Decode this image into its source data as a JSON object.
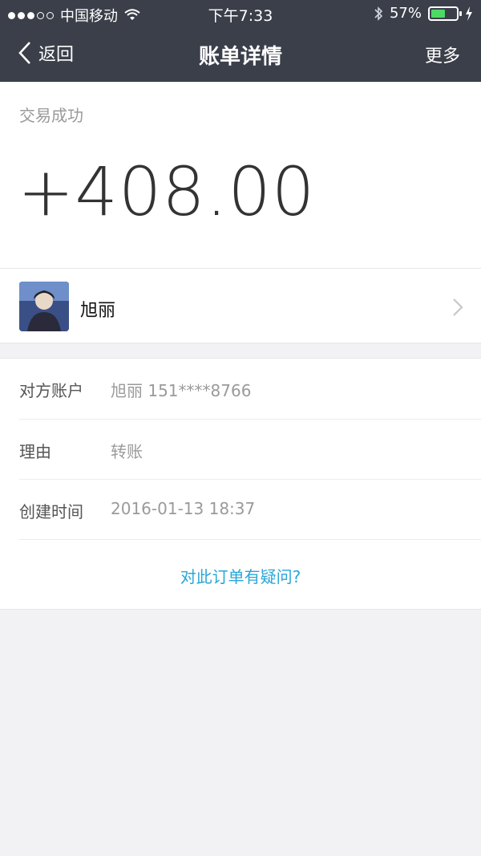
{
  "statusbar": {
    "carrier": "中国移动",
    "time": "下午7:33",
    "battery": "57%",
    "battery_level": 0.57
  },
  "nav": {
    "back_label": "返回",
    "title": "账单详情",
    "more_label": "更多"
  },
  "summary": {
    "status": "交易成功",
    "amount": "+408.00"
  },
  "user": {
    "name": "旭丽"
  },
  "details": [
    {
      "label": "对方账户",
      "value": "旭丽 151****8766"
    },
    {
      "label": "理由",
      "value": "转账"
    },
    {
      "label": "创建时间",
      "value": "2016-01-13 18:37"
    }
  ],
  "question_link": "对此订单有疑问?",
  "colors": {
    "navbar": "#3b3f4a",
    "link": "#2aa6d8",
    "background": "#f2f2f4"
  }
}
